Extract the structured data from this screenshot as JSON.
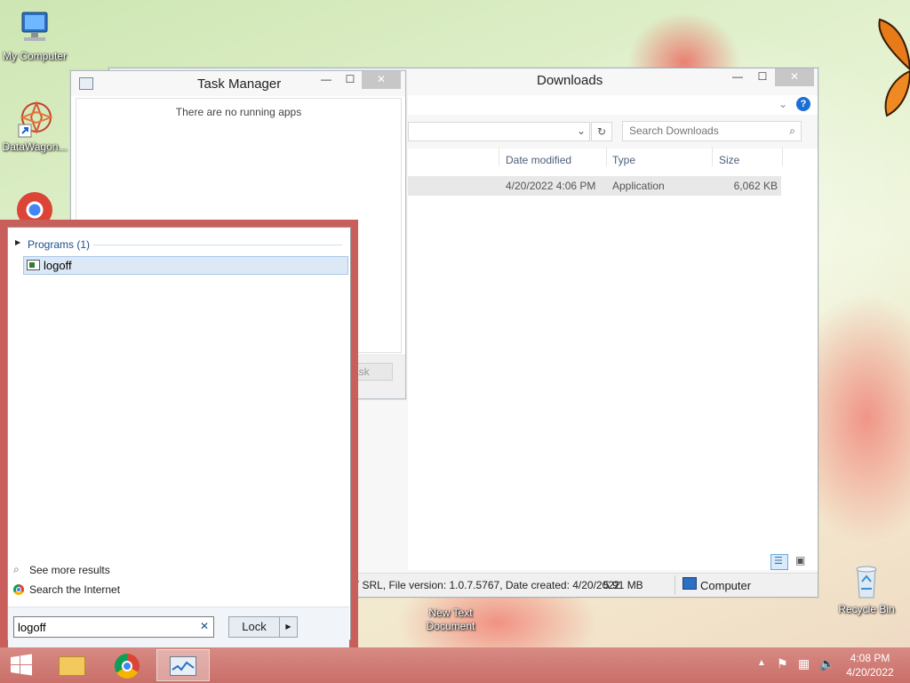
{
  "desktop": {
    "icons": [
      {
        "label": "My Computer"
      },
      {
        "label": "DataWagon..."
      },
      {
        "label": "New Text\nDocument"
      },
      {
        "label": "Recycle Bin"
      }
    ]
  },
  "task_manager": {
    "title": "Task Manager",
    "empty_message": "There are no running apps",
    "end_task_label": "ask"
  },
  "explorer": {
    "title": "Downloads",
    "search_placeholder": "Search Downloads",
    "columns": [
      "Date modified",
      "Type",
      "Size"
    ],
    "rows": [
      {
        "date": "4/20/2022 4:06 PM",
        "type": "Application",
        "size": "6,062 KB"
      }
    ],
    "status_text": "T SRL, File version: 1.0.7.5767, Date created: 4/20/2022",
    "status_size": "5.91 MB",
    "status_location": "Computer"
  },
  "start_search": {
    "group_label": "Programs (1)",
    "result": "logoff",
    "see_more": "See more results",
    "search_internet": "Search the Internet",
    "query": "logoff",
    "lock_label": "Lock"
  },
  "taskbar": {
    "time": "4:08 PM",
    "date": "4/20/2022"
  },
  "colors": {
    "start_panel_border": "#c95f5b",
    "taskbar": "#cf7c75",
    "selection": "#dce8f5"
  }
}
